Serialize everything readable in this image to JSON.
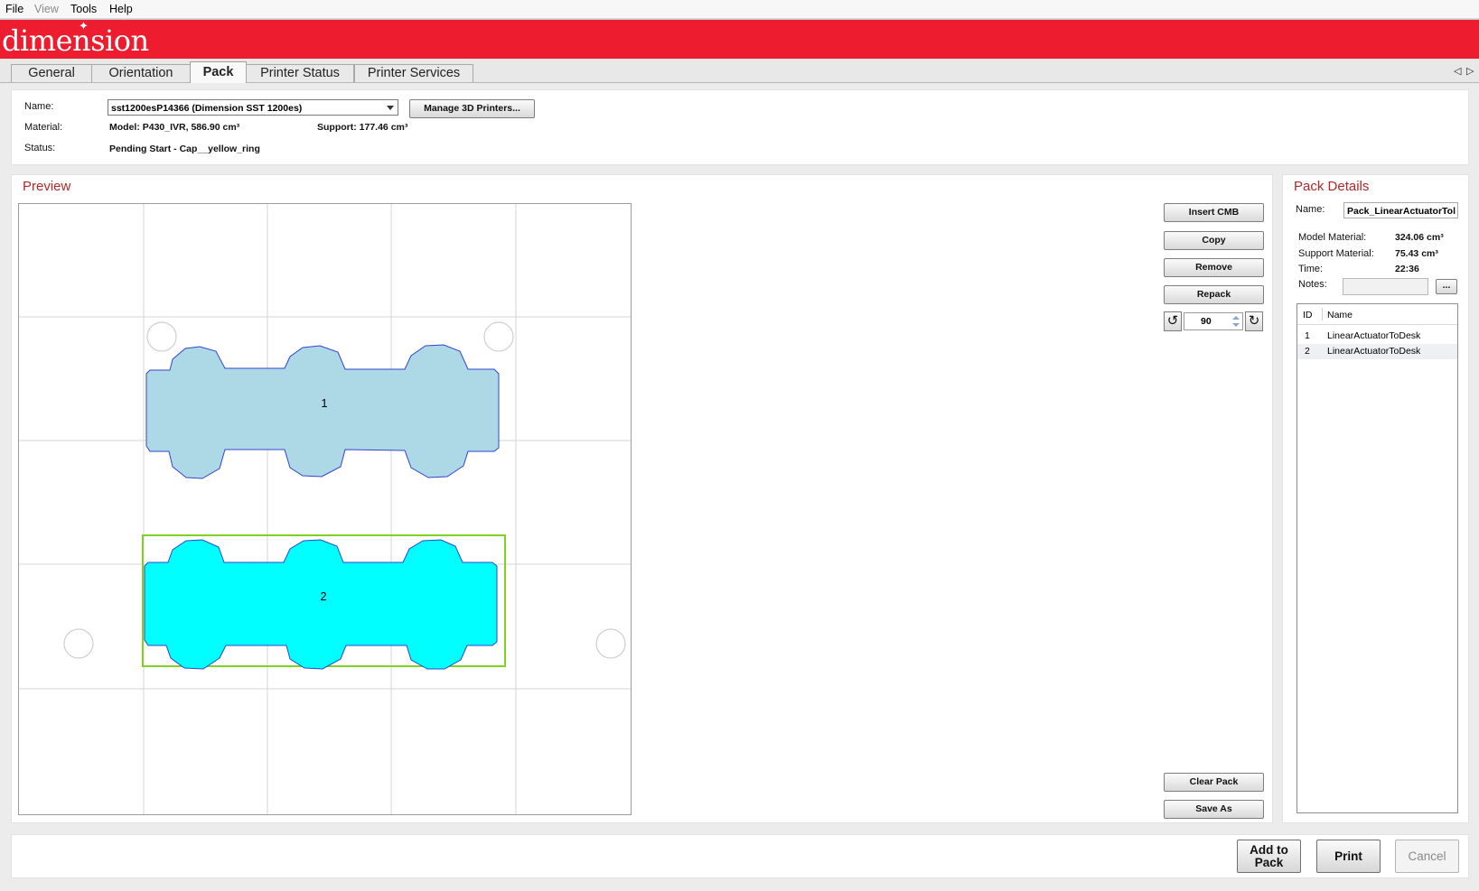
{
  "menu": {
    "file": "File",
    "view": "View",
    "tools": "Tools",
    "help": "Help"
  },
  "brand": {
    "logo": "dimension",
    "color": "#ed1c2e"
  },
  "tabs": [
    "General",
    "Orientation",
    "Pack",
    "Printer Status",
    "Printer Services"
  ],
  "active_tab": "Pack",
  "printer": {
    "name_label": "Name:",
    "name_value": "sst1200esP14366  (Dimension SST 1200es)",
    "manage_button": "Manage 3D Printers...",
    "material_label": "Material:",
    "material_model": "Model:  P430_IVR,  586.90 cm³",
    "material_support": "Support:  177.46 cm³",
    "status_label": "Status:",
    "status_value": "Pending Start  -  Cap__yellow_ring"
  },
  "preview": {
    "title": "Preview",
    "parts": [
      {
        "id": "1",
        "color": "#add8e6",
        "selected": false
      },
      {
        "id": "2",
        "color": "#00ffff",
        "selected": true
      }
    ],
    "selection_color": "#7ed321"
  },
  "actions": {
    "insert_cmb": "Insert CMB",
    "copy": "Copy",
    "remove": "Remove",
    "repack": "Repack",
    "rotation_value": "90",
    "clear_pack": "Clear Pack",
    "save_as": "Save As"
  },
  "pack_details": {
    "title": "Pack Details",
    "name_label": "Name:",
    "name_value": "Pack_LinearActuatorTol",
    "model_material_label": "Model Material:",
    "model_material_value": "324.06 cm³",
    "support_material_label": "Support Material:",
    "support_material_value": "75.43 cm³",
    "time_label": "Time:",
    "time_value": "22:36",
    "notes_label": "Notes:",
    "notes_button": "...",
    "columns": [
      "ID",
      "Name"
    ],
    "rows": [
      {
        "id": "1",
        "name": "LinearActuatorToDesk"
      },
      {
        "id": "2",
        "name": "LinearActuatorToDesk"
      }
    ]
  },
  "footer": {
    "add_to_pack_line1": "Add to",
    "add_to_pack_line2": "Pack",
    "print": "Print",
    "cancel": "Cancel"
  }
}
